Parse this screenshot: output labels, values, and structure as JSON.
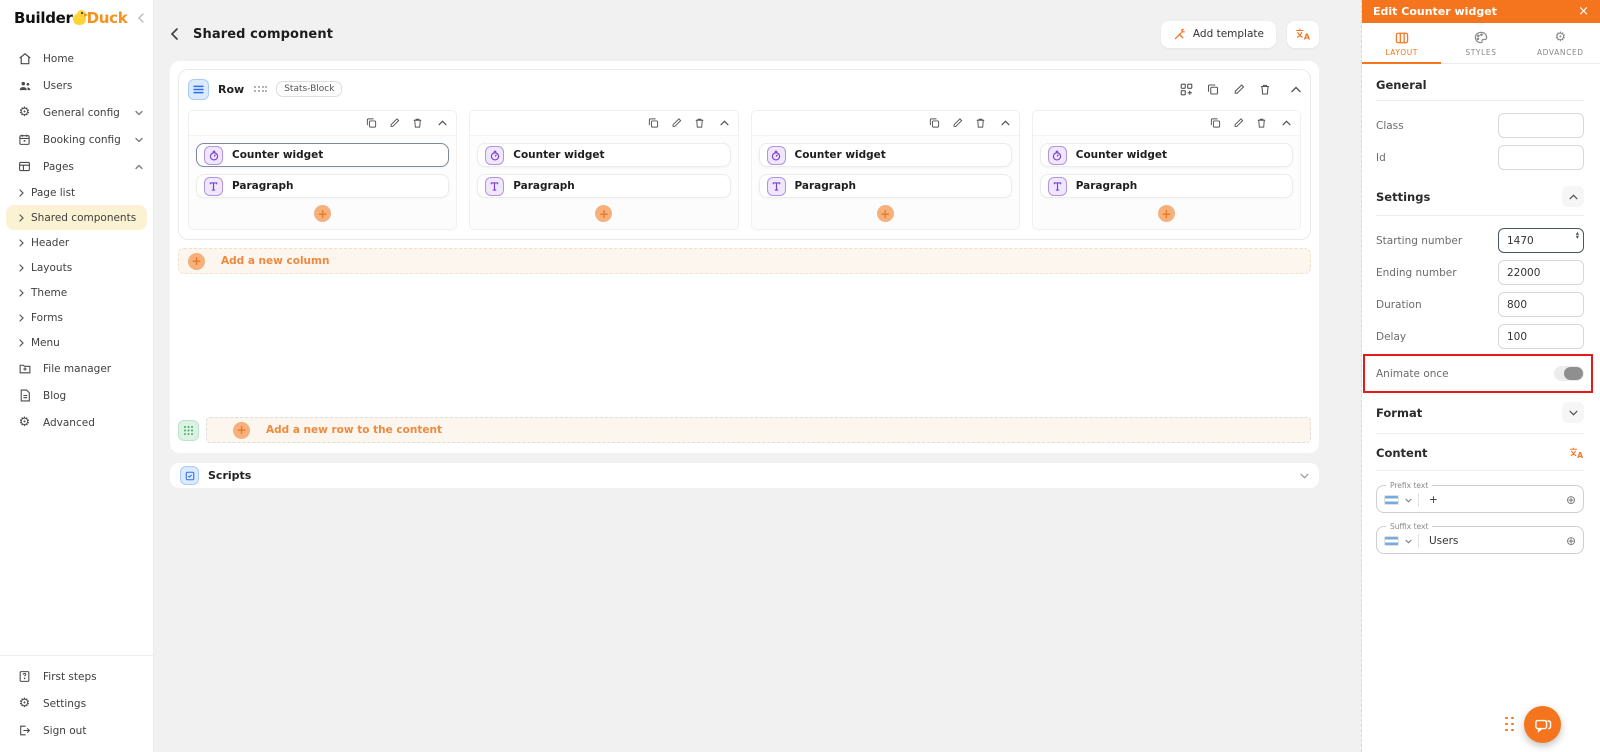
{
  "brand": {
    "word1": "Builder",
    "word2": "Duck",
    "logo_icon": "duck-icon"
  },
  "sidebar": {
    "main_items": [
      {
        "label": "Home",
        "icon": "home-icon"
      },
      {
        "label": "Users",
        "icon": "users-icon"
      },
      {
        "label": "General config",
        "icon": "gear-icon",
        "chevron": "down"
      },
      {
        "label": "Booking config",
        "icon": "calendar-icon",
        "chevron": "down"
      },
      {
        "label": "Pages",
        "icon": "pages-icon",
        "chevron": "up"
      }
    ],
    "pages_children": [
      {
        "label": "Page list"
      },
      {
        "label": "Shared components",
        "active": true
      },
      {
        "label": "Header"
      },
      {
        "label": "Layouts"
      },
      {
        "label": "Theme"
      },
      {
        "label": "Forms"
      },
      {
        "label": "Menu"
      }
    ],
    "secondary_items": [
      {
        "label": "File manager",
        "icon": "folder-plus-icon"
      },
      {
        "label": "Blog",
        "icon": "document-icon"
      },
      {
        "label": "Advanced",
        "icon": "advanced-gear-icon"
      }
    ],
    "footer_items": [
      {
        "label": "First steps",
        "icon": "guide-book-icon"
      },
      {
        "label": "Settings",
        "icon": "settings-gear-icon"
      },
      {
        "label": "Sign out",
        "icon": "sign-out-icon"
      }
    ]
  },
  "header": {
    "title": "Shared component",
    "add_template_label": "Add template"
  },
  "canvas": {
    "row_label": "Row",
    "row_tag": "Stats-Block",
    "columns": [
      {
        "items": [
          "Counter widget",
          "Paragraph"
        ]
      },
      {
        "items": [
          "Counter widget",
          "Paragraph"
        ]
      },
      {
        "items": [
          "Counter widget",
          "Paragraph"
        ]
      },
      {
        "items": [
          "Counter widget",
          "Paragraph"
        ]
      }
    ],
    "add_column_label": "Add a new column",
    "add_row_label": "Add a new row to the content",
    "scripts_label": "Scripts",
    "plus_glyph": "+"
  },
  "panel": {
    "title": "Edit Counter widget",
    "close_glyph": "×",
    "tabs": [
      {
        "label": "LAYOUT",
        "active": true
      },
      {
        "label": "STYLES",
        "active": false
      },
      {
        "label": "ADVANCED",
        "active": false
      }
    ],
    "sections": {
      "general": "General",
      "settings": "Settings",
      "format": "Format",
      "content": "Content"
    },
    "fields": {
      "class_label": "Class",
      "class_value": "",
      "id_label": "Id",
      "id_value": "",
      "starting_label": "Starting number",
      "starting_value": "1470",
      "ending_label": "Ending number",
      "ending_value": "22000",
      "duration_label": "Duration",
      "duration_value": "800",
      "delay_label": "Delay",
      "delay_value": "100",
      "animate_label": "Animate once",
      "animate_on": false,
      "prefix_label": "Prefix text",
      "prefix_value": "+",
      "suffix_label": "Suffix text",
      "suffix_value": "Users",
      "circle_plus_glyph": "⊕"
    }
  },
  "colors": {
    "accent_orange": "#F4751D",
    "active_nav_bg": "#FAF2D2",
    "annotation_red": "#E41A1A",
    "widget_purple": "#7A3FD1",
    "row_blue": "#2F6FED",
    "grid_green": "#3AA65C"
  }
}
